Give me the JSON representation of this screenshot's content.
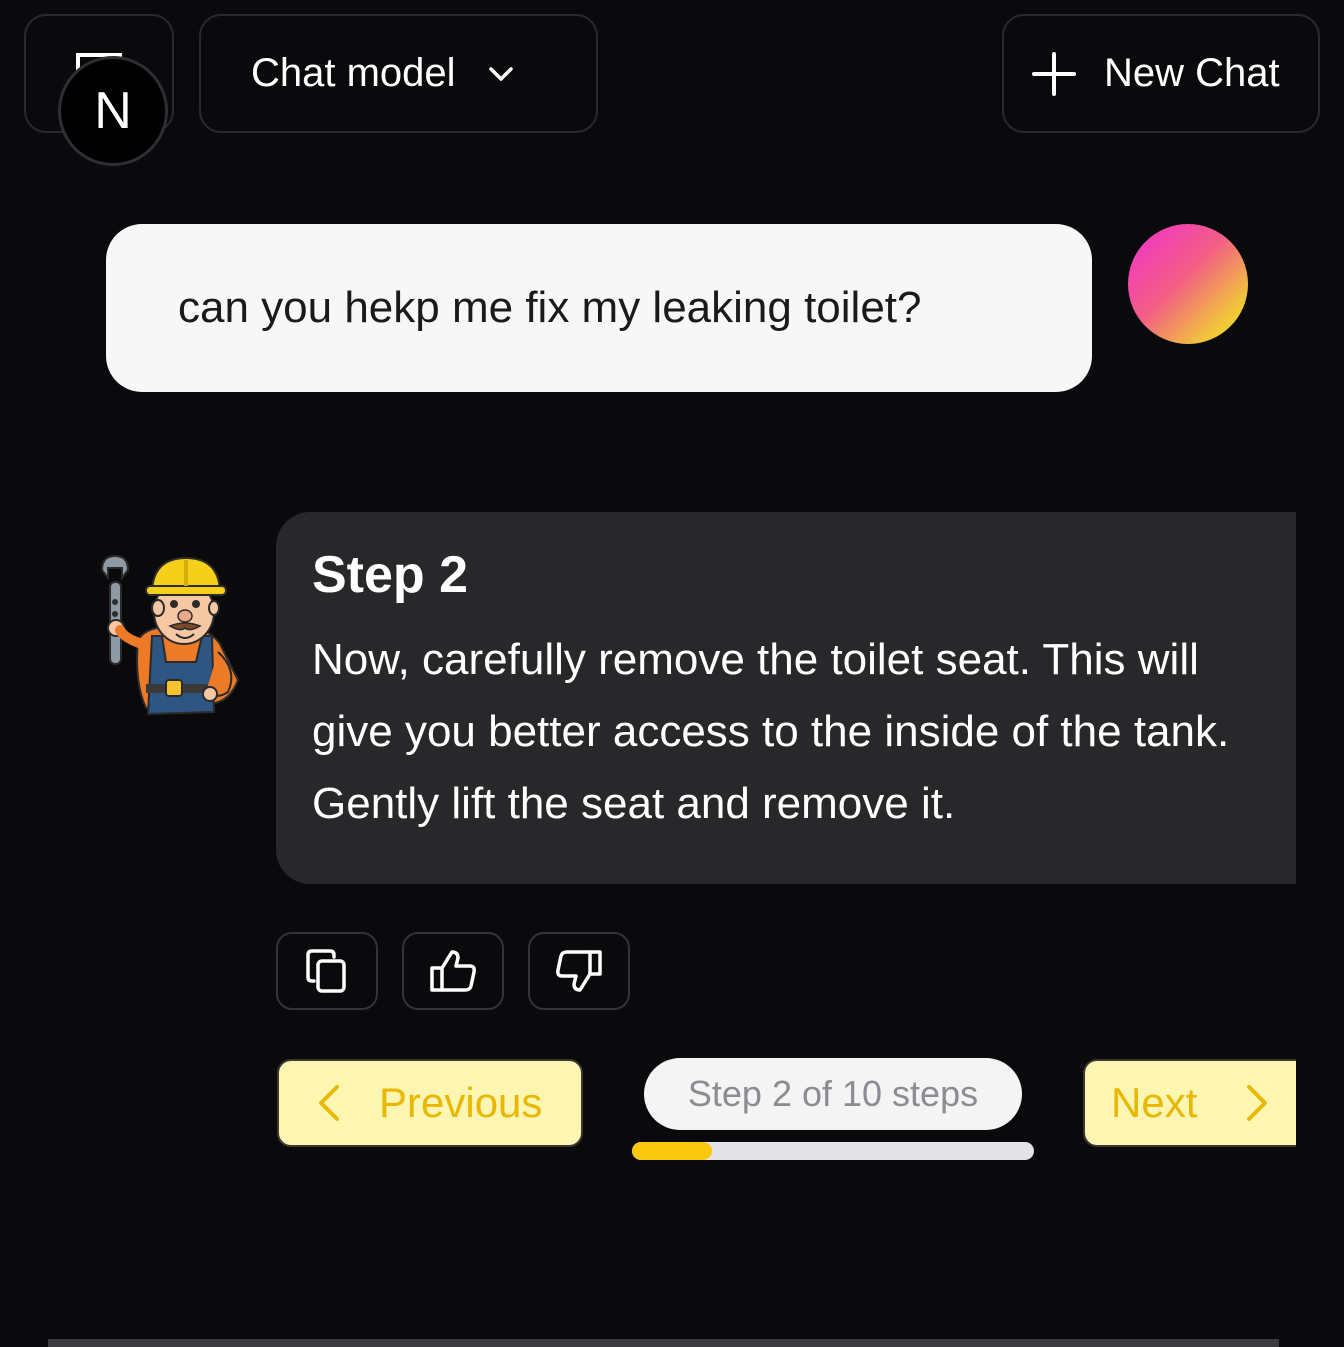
{
  "header": {
    "logo_letter": "N",
    "model_selector_label": "Chat model",
    "new_chat_label": "New Chat"
  },
  "user_message": {
    "text": "can you hekp me fix my leaking toilet?"
  },
  "assistant_message": {
    "title": "Step 2",
    "body": "Now, carefully remove the toilet seat. This will give you better access to the inside of the tank. Gently lift the seat and remove it."
  },
  "actions": {
    "copy": "copy-icon",
    "upvote": "thumbs-up-icon",
    "downvote": "thumbs-down-icon"
  },
  "navigation": {
    "previous_label": "Previous",
    "next_label": "Next",
    "step_counter": "Step 2 of 10 steps",
    "progress": 0.2
  },
  "colors": {
    "background": "#0a0a0c",
    "accent_yellow": "#f9c70c",
    "button_yellow": "#fdf6b3",
    "assistant_bubble": "#28282b",
    "user_bubble": "#f7f7f8"
  }
}
